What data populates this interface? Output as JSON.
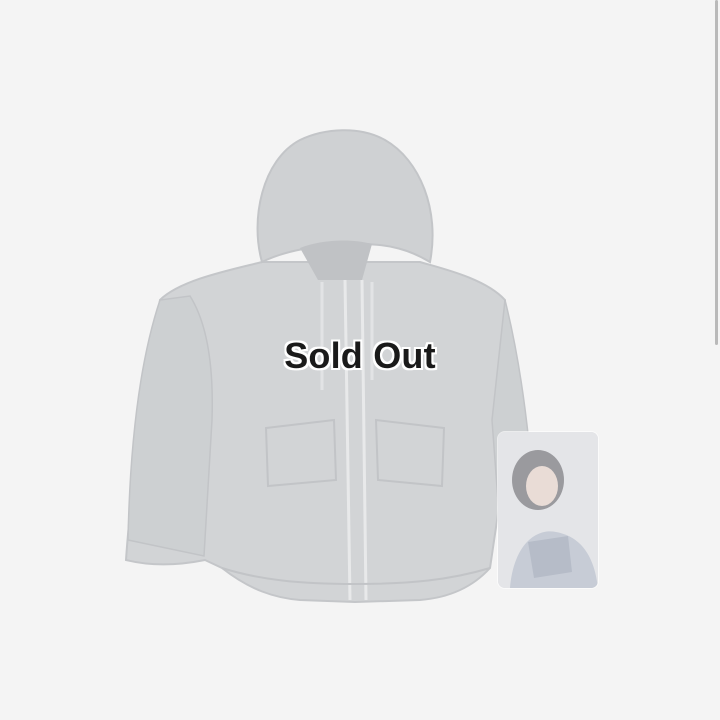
{
  "product": {
    "image_icon": "hoodie-image",
    "photocard_icon": "photocard-image",
    "status_label": "Sold Out"
  },
  "colors": {
    "background": "#f4f4f4",
    "hoodie": "#d2d4d6",
    "label_text": "#1a1a1a"
  }
}
